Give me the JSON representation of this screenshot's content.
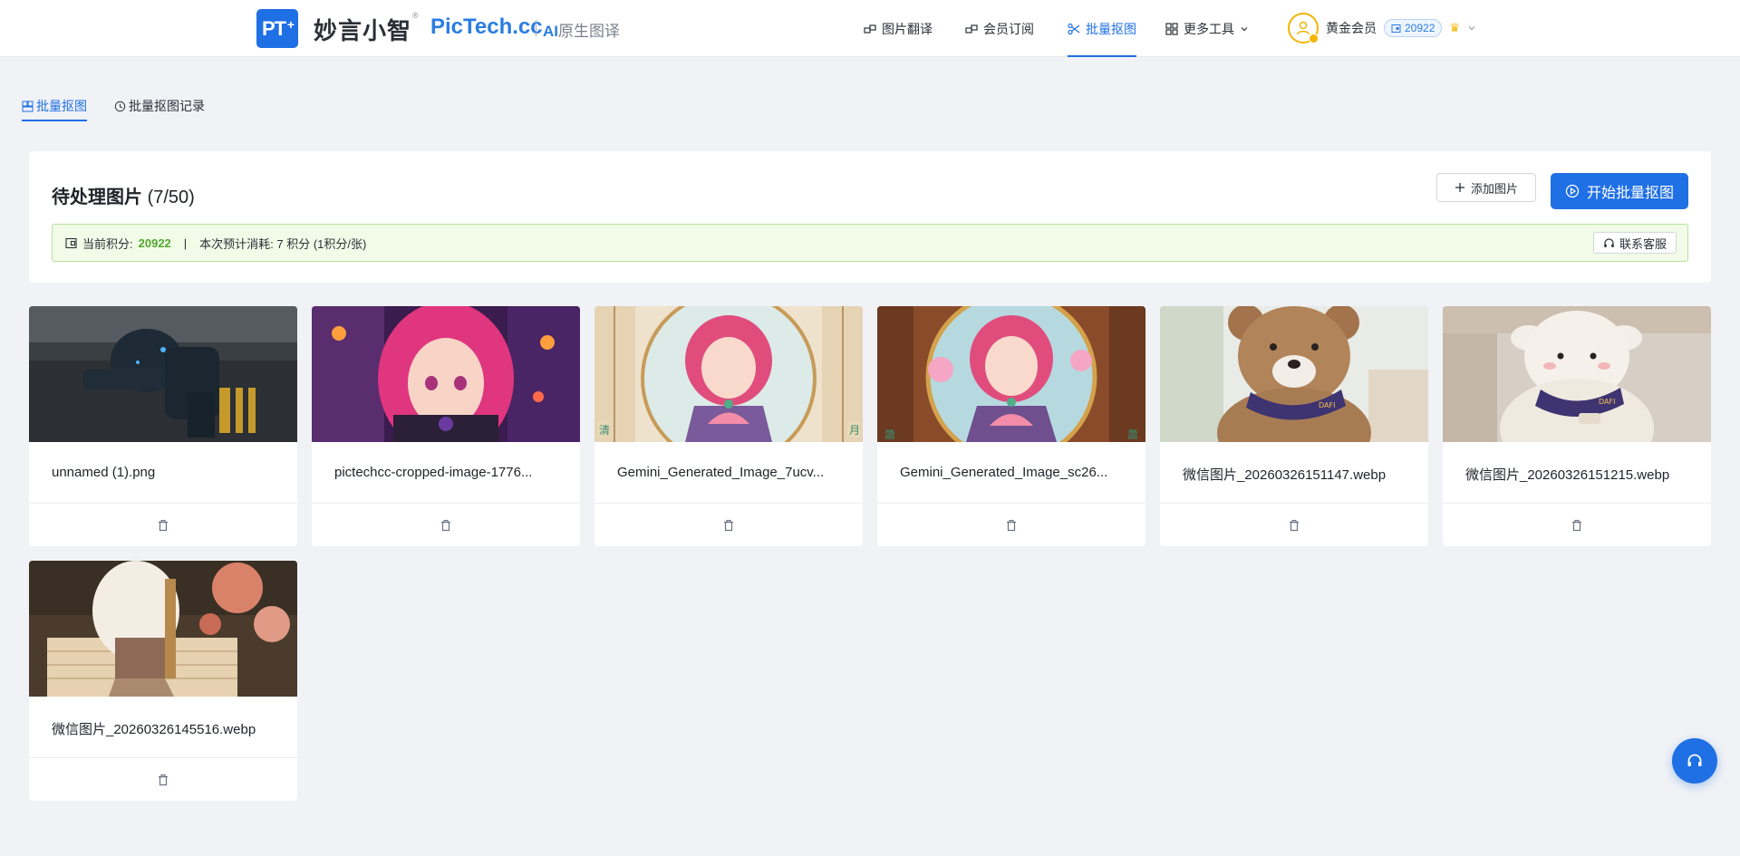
{
  "header": {
    "logo_text": "PT",
    "logo_plus": "+",
    "brand_cn": "妙言小智",
    "brand_reg": "®",
    "brand_en": "PicTech.cc",
    "brand_sub_ai": "AI",
    "brand_sub": "原生图译",
    "nav": [
      {
        "label": "图片翻译",
        "icon": "link-icon"
      },
      {
        "label": "会员订阅",
        "icon": "link-icon"
      },
      {
        "label": "批量抠图",
        "icon": "scissors-icon",
        "active": true
      },
      {
        "label": "更多工具",
        "icon": "grid-icon"
      }
    ],
    "user": {
      "name": "黄金会员",
      "points": "20922",
      "icon": "user-icon"
    }
  },
  "tabs": [
    {
      "label": "批量抠图",
      "icon": "stack-icon",
      "active": true
    },
    {
      "label": "批量抠图记录",
      "icon": "clock-icon"
    }
  ],
  "panel": {
    "title": "待处理图片",
    "count": "(7/50)",
    "add_button": "添加图片",
    "start_button": "开始批量抠图",
    "info": {
      "points_label": "当前积分:",
      "points_value": "20922",
      "separator": "|",
      "estimate": "本次预计消耗: 7 积分 (1积分/张)",
      "service_button": "联系客服"
    }
  },
  "images": [
    {
      "name": "unnamed (1).png"
    },
    {
      "name": "pictechcc-cropped-image-1776..."
    },
    {
      "name": "Gemini_Generated_Image_7ucv..."
    },
    {
      "name": "Gemini_Generated_Image_sc26..."
    },
    {
      "name": "微信图片_20260326151147.webp"
    },
    {
      "name": "微信图片_20260326151215.webp"
    },
    {
      "name": "微信图片_20260326145516.webp"
    }
  ],
  "colors": {
    "accent": "#1f6fe5",
    "points_green": "#52a82d",
    "info_bg": "#f1fbe8",
    "gold": "#f4b400"
  }
}
